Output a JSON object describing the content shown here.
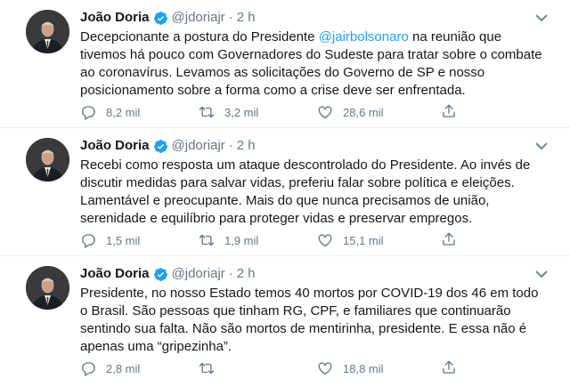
{
  "tweets": [
    {
      "name": "João Doria",
      "handle": "@jdoriajr",
      "dot": "·",
      "time": "2 h",
      "text_before": "Decepcionante a postura do Presidente ",
      "mention": "@jairbolsonaro",
      "text_after": " na reunião que tivemos há pouco com Governadores do Sudeste para tratar sobre o combate ao coronavírus. Levamos as solicitações do Governo de SP e nosso posicionamento sobre a forma como a crise deve ser enfrentada.",
      "replies": "8,2 mil",
      "retweets": "3,2 mil",
      "likes": "28,6 mil"
    },
    {
      "name": "João Doria",
      "handle": "@jdoriajr",
      "dot": "·",
      "time": "2 h",
      "text_before": "Recebi como resposta um ataque descontrolado do Presidente. Ao invés de discutir medidas para salvar vidas, preferiu falar sobre política e eleições. Lamentável e preocupante. Mais do que nunca precisamos de união, serenidade e equilíbrio para proteger vidas e preservar empregos.",
      "mention": "",
      "text_after": "",
      "replies": "1,5 mil",
      "retweets": "1,9 mil",
      "likes": "15,1 mil"
    },
    {
      "name": "João Doria",
      "handle": "@jdoriajr",
      "dot": "·",
      "time": "2 h",
      "text_before": "Presidente, no nosso Estado temos 40 mortos por COVID-19 dos 46 em todo o Brasil. São pessoas que tinham RG, CPF, e familiares que continuarão sentindo sua falta. Não são mortos de mentirinha, presidente. E essa não é apenas uma “gripezinha”.",
      "mention": "",
      "text_after": "",
      "replies": "2,8 mil",
      "retweets": "",
      "likes": "18,8 mil"
    }
  ],
  "colors": {
    "text": "#14171a",
    "secondary": "#657786",
    "accent": "#1da1f2",
    "border": "#e6ecf0"
  },
  "icons": {
    "verified": "verified-badge-icon",
    "caret": "chevron-down-icon",
    "reply": "reply-icon",
    "retweet": "retweet-icon",
    "like": "heart-icon",
    "share": "share-icon"
  }
}
